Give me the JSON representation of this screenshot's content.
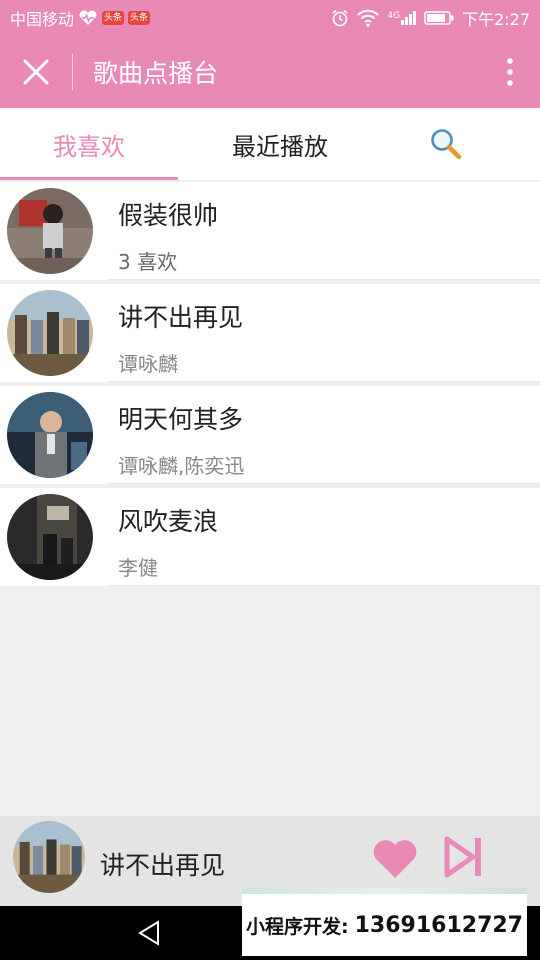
{
  "status": {
    "carrier": "中国移动",
    "badge1": "头条",
    "badge2": "头条",
    "network": "4G",
    "time": "下午2:27"
  },
  "header": {
    "title": "歌曲点播台",
    "icons": [
      "close-icon",
      "more-icon"
    ]
  },
  "tabs": [
    {
      "label": "我喜欢",
      "active": true
    },
    {
      "label": "最近播放",
      "active": false
    }
  ],
  "songs": [
    {
      "title": "假装很帅",
      "subtitle": "3 喜欢"
    },
    {
      "title": "讲不出再见",
      "subtitle": "谭咏麟"
    },
    {
      "title": "明天何其多",
      "subtitle": "谭咏麟,陈奕迅"
    },
    {
      "title": "风吹麦浪",
      "subtitle": "李健"
    }
  ],
  "player": {
    "now_playing": "讲不出再见",
    "accent_color": "#e989b5"
  },
  "overlay": {
    "label": "小程序开发:",
    "phone": "13691612727"
  },
  "colors": {
    "brand": "#e989b5",
    "background": "#efefef"
  }
}
